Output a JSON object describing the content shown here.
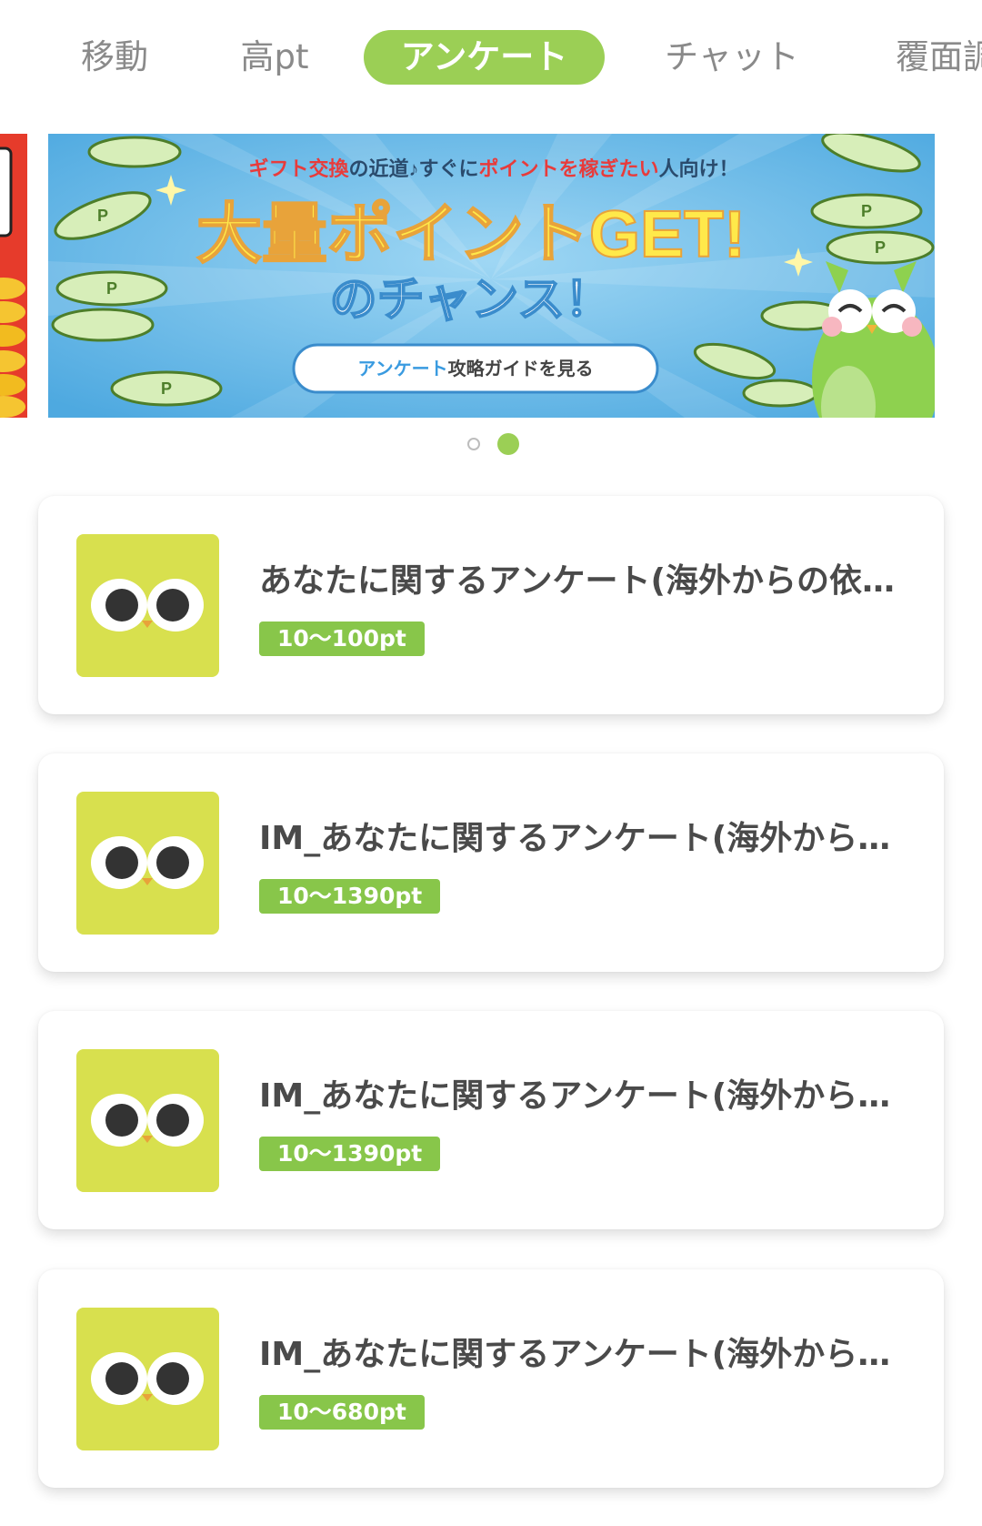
{
  "tabs": [
    {
      "label": "移動",
      "active": false
    },
    {
      "label": "高pt",
      "active": false
    },
    {
      "label": "アンケート",
      "active": true
    },
    {
      "label": "チャット",
      "active": false
    },
    {
      "label": "覆面調査",
      "active": false
    }
  ],
  "banner": {
    "subtitle_a": "ギフト交換",
    "subtitle_b": "の近道♪すぐに",
    "subtitle_c": "ポイントを稼ぎたい",
    "subtitle_d": "人向け！",
    "headline": "大量ポイントGET!",
    "headline2": "のチャンス！",
    "button_a": "アンケート",
    "button_b": "攻略ガイドを見る",
    "coin_letter": "P"
  },
  "carousel": {
    "slide_count": 2,
    "active_index": 1
  },
  "surveys": [
    {
      "title": "あなたに関するアンケート(海外からの依頼)",
      "points": "10〜100pt"
    },
    {
      "title": "IM_あなたに関するアンケート(海外からの依頼)",
      "points": "10〜1390pt"
    },
    {
      "title": "IM_あなたに関するアンケート(海外からの依頼)",
      "points": "10〜1390pt"
    },
    {
      "title": "IM_あなたに関するアンケート(海外からの依頼)",
      "points": "10〜680pt"
    }
  ],
  "colors": {
    "accent": "#9bcf55",
    "badge": "#88c64a",
    "icon_bg": "#d8e04e",
    "banner_sky": "#5ab4e4",
    "headline": "#ffe94a"
  }
}
